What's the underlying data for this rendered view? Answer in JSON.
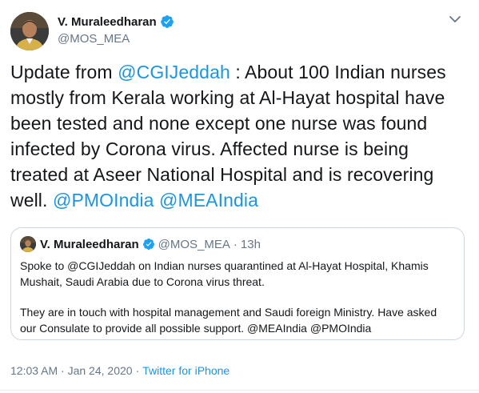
{
  "author": {
    "display_name": "V. Muraleedharan",
    "handle": "@MOS_MEA"
  },
  "tweet": {
    "segments": [
      {
        "type": "text",
        "value": "Update from "
      },
      {
        "type": "mention",
        "value": "@CGIJeddah"
      },
      {
        "type": "text",
        "value": " : About 100 Indian nurses mostly from Kerala working at Al-Hayat hospital have been tested and none except one nurse was found infected by Corona virus. Affected nurse is being treated at Aseer National Hospital and is recovering well. "
      },
      {
        "type": "mention",
        "value": "@PMOIndia"
      },
      {
        "type": "text",
        "value": " "
      },
      {
        "type": "mention",
        "value": "@MEAIndia"
      }
    ]
  },
  "quoted_tweet": {
    "display_name": "V. Muraleedharan",
    "handle": "@MOS_MEA",
    "dot": "·",
    "time": "13h",
    "paragraph_1": "Spoke to @CGIJeddah on Indian nurses quarantined at Al-Hayat Hospital, Khamis Mushait, Saudi Arabia due to Corona virus threat.",
    "paragraph_2": "They are in touch with hospital management and Saudi foreign Ministry. Have asked our Consulate to provide all possible support. @MEAIndia @PMOIndia"
  },
  "meta": {
    "timestamp": "12:03 AM · Jan 24, 2020",
    "separator": "·",
    "source": "Twitter for iPhone"
  },
  "icons": {
    "verified": "verified-badge-icon",
    "more": "chevron-down-icon"
  },
  "colors": {
    "link": "#1b95e0",
    "verified": "#1da1f2",
    "secondary_text": "#657786",
    "border": "#ccd6dd"
  }
}
